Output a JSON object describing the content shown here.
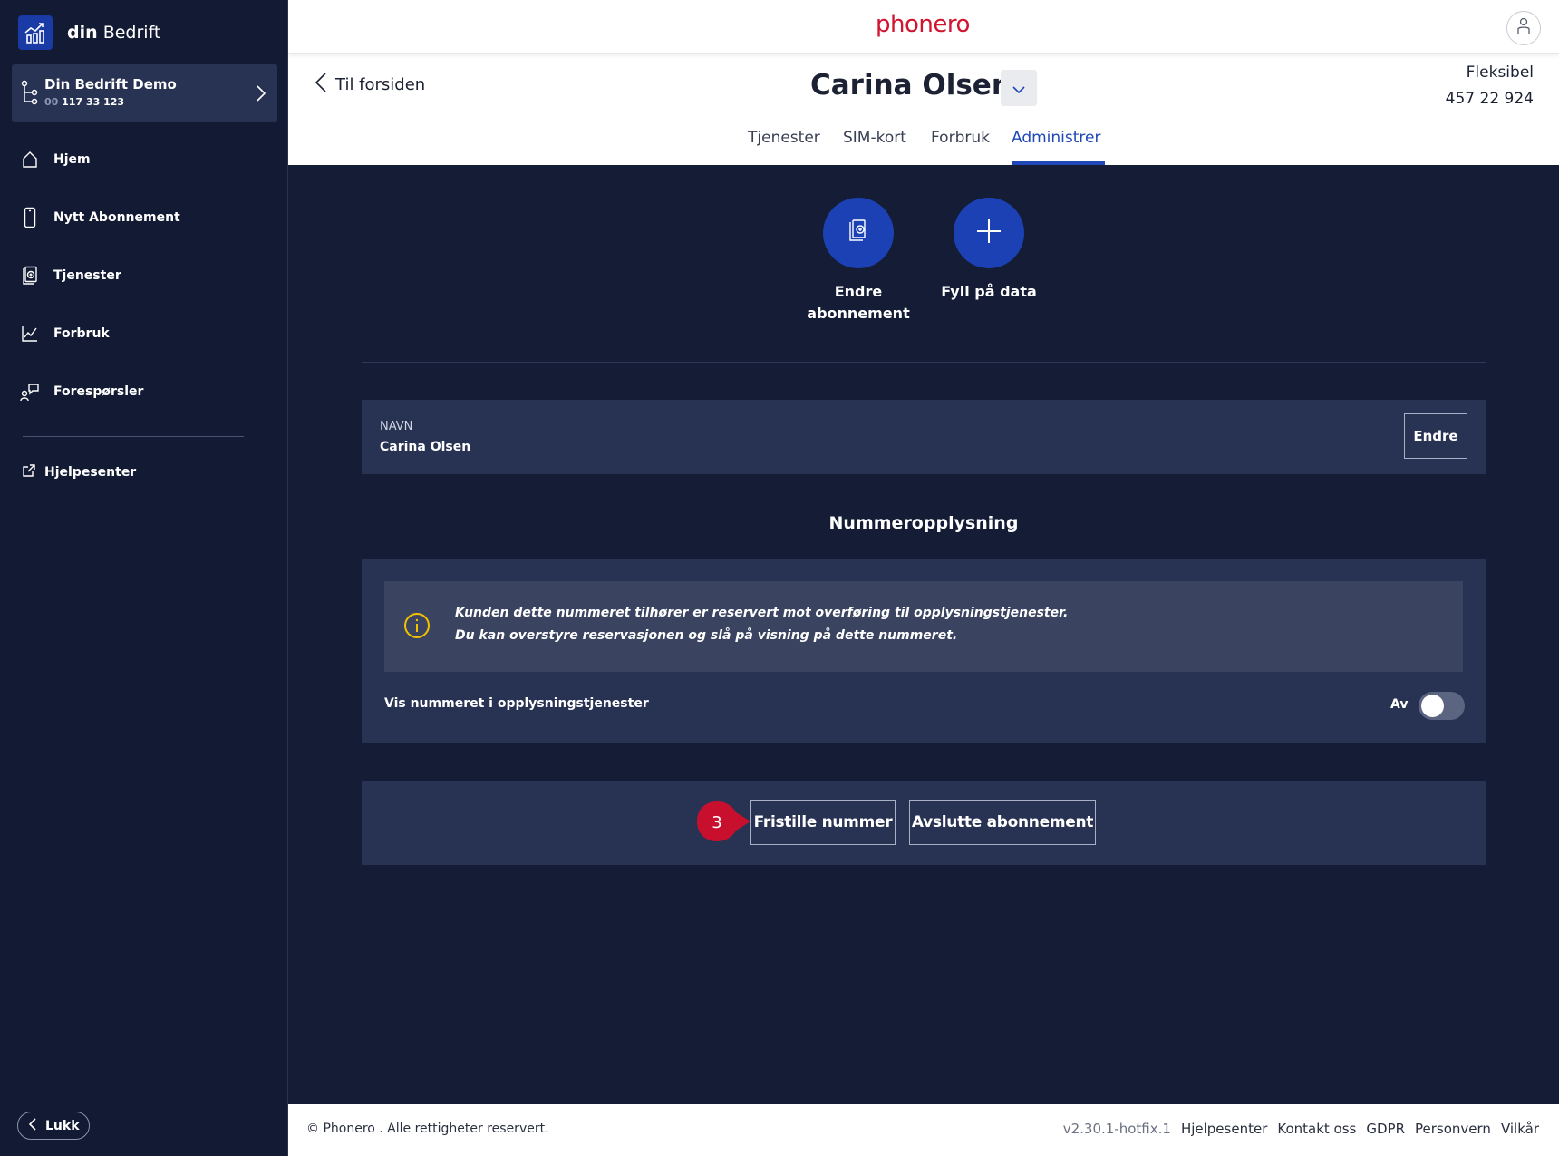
{
  "sidebar": {
    "brand": {
      "prefix": "din",
      "name": "Bedrift"
    },
    "company": {
      "name": "Din Bedrift Demo",
      "number_prefix": "00",
      "number": "117 33 123"
    },
    "nav": [
      {
        "label": "Hjem",
        "icon": "home-icon"
      },
      {
        "label": "Nytt Abonnement",
        "icon": "phone-icon"
      },
      {
        "label": "Tjenester",
        "icon": "services-icon"
      },
      {
        "label": "Forbruk",
        "icon": "usage-chart-icon"
      },
      {
        "label": "Forespørsler",
        "icon": "requests-icon"
      }
    ],
    "help": "Hjelpesenter",
    "close": "Lukk"
  },
  "header": {
    "logo": "phonero",
    "back": "Til forsiden",
    "subscriber": "Carina Olsen",
    "plan": "Fleksibel",
    "phone": "457 22 924",
    "tabs": [
      "Tjenester",
      "SIM-kort",
      "Forbruk",
      "Administrer"
    ],
    "active_tab": "Administrer"
  },
  "actions": {
    "change_line1": "Endre",
    "change_line2": "abonnement",
    "topup": "Fyll på data"
  },
  "name_card": {
    "label": "NAVN",
    "value": "Carina Olsen",
    "edit": "Endre"
  },
  "directory": {
    "title": "Nummeropplysning",
    "info_line1": "Kunden dette nummeret tilhører er reservert mot overføring til opplysningstjenester.",
    "info_line2": "Du kan overstyre reservasjonen og slå på visning på dette nummeret.",
    "toggle_label": "Vis nummeret i opplysningstjenester",
    "toggle_state": "Av",
    "toggle_on": false
  },
  "buttons": {
    "release": "Fristille nummer",
    "terminate": "Avslutte abonnement",
    "step": "3"
  },
  "footer": {
    "copyright": "© Phonero . Alle rettigheter reservert.",
    "version": "v2.30.1-hotfix.1",
    "links": [
      "Hjelpesenter",
      "Kontakt oss",
      "GDPR",
      "Personvern",
      "Vilkår"
    ]
  },
  "colors": {
    "accent": "#1f47b8",
    "brand_red": "#d1142f",
    "background": "#141c36",
    "card": "#283253",
    "step_marker": "#c8102e",
    "info_icon": "#f2c200"
  }
}
